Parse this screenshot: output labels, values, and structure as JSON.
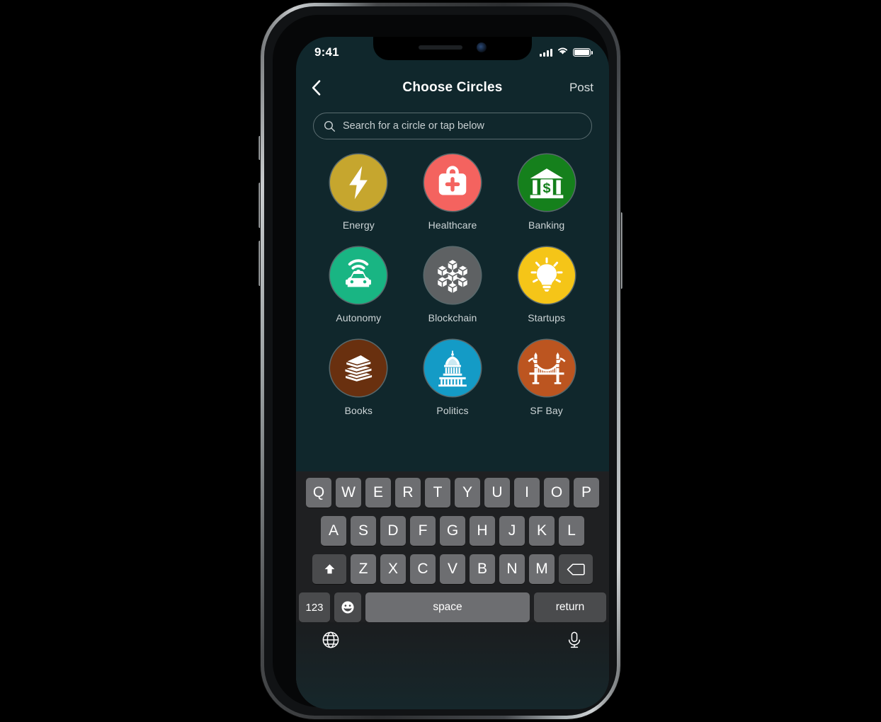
{
  "status_bar": {
    "time": "9:41",
    "signal_icon": "cellular-bars-icon",
    "wifi_icon": "wifi-icon",
    "battery_icon": "battery-full-icon"
  },
  "nav_bar": {
    "back_icon": "chevron-left-icon",
    "title": "Choose Circles",
    "post_label": "Post"
  },
  "search": {
    "icon": "search-icon",
    "placeholder": "Search for a circle or tap below",
    "value": ""
  },
  "circles": [
    {
      "label": "Energy",
      "icon": "lightning-bolt-icon",
      "bg": "#C6A62E",
      "fg": "#ffffff"
    },
    {
      "label": "Healthcare",
      "icon": "medical-bag-icon",
      "bg": "#F4635F",
      "fg": "#ffffff"
    },
    {
      "label": "Banking",
      "icon": "bank-dollar-icon",
      "bg": "#15801C",
      "fg": "#ffffff"
    },
    {
      "label": "Autonomy",
      "icon": "self-driving-car-icon",
      "bg": "#19B583",
      "fg": "#ffffff"
    },
    {
      "label": "Blockchain",
      "icon": "blockchain-nodes-icon",
      "bg": "#5E6163",
      "fg": "#ffffff"
    },
    {
      "label": "Startups",
      "icon": "lightbulb-icon",
      "bg": "#F5C518",
      "fg": "#ffffff"
    },
    {
      "label": "Books",
      "icon": "book-stack-icon",
      "bg": "#69300F",
      "fg": "#ffffff"
    },
    {
      "label": "Politics",
      "icon": "capitol-building-icon",
      "bg": "#149BC6",
      "fg": "#ffffff"
    },
    {
      "label": "SF Bay",
      "icon": "golden-gate-bridge-icon",
      "bg": "#BC5520",
      "fg": "#ffffff"
    }
  ],
  "keyboard": {
    "row1": [
      "Q",
      "W",
      "E",
      "R",
      "T",
      "Y",
      "U",
      "I",
      "O",
      "P"
    ],
    "row2": [
      "A",
      "S",
      "D",
      "F",
      "G",
      "H",
      "J",
      "K",
      "L"
    ],
    "row3": [
      "Z",
      "X",
      "C",
      "V",
      "B",
      "N",
      "M"
    ],
    "shift_icon": "shift-up-arrow-icon",
    "delete_icon": "backspace-icon",
    "numbers_label": "123",
    "emoji_icon": "smiley-face-icon",
    "space_label": "space",
    "return_label": "return",
    "globe_icon": "globe-icon",
    "mic_icon": "microphone-icon"
  },
  "theme": {
    "screen_bg": "#10272c",
    "keyboard_bg": "#1f2022",
    "key_bg": "#6d6e71",
    "key_alt_bg": "#4a4b4d",
    "text_primary": "#ffffff",
    "text_secondary": "#cdd5d7"
  }
}
